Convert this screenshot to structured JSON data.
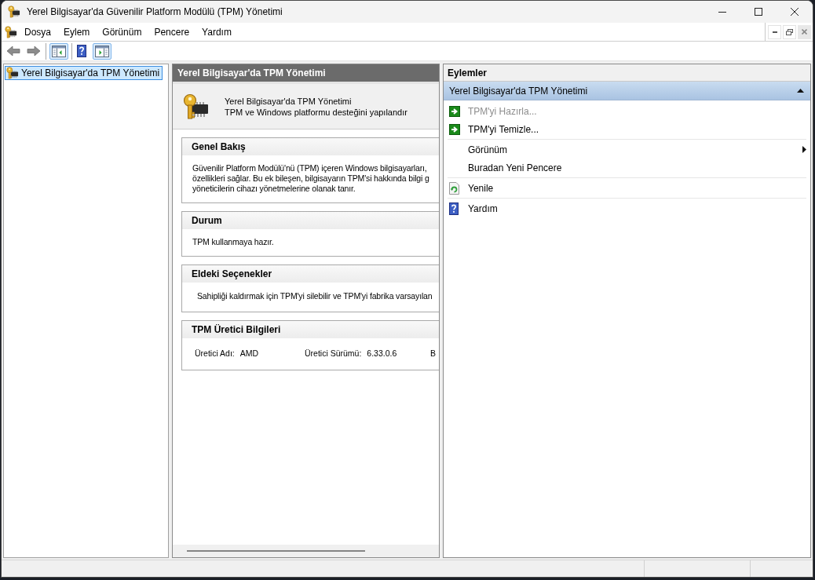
{
  "window": {
    "title": "Yerel Bilgisayar'da Güvenilir Platform Modülü (TPM) Yönetimi"
  },
  "menu_bar": {
    "items": [
      "Dosya",
      "Eylem",
      "Görünüm",
      "Pencere",
      "Yardım"
    ]
  },
  "toolbar": {
    "history": [
      {
        "kind": "back",
        "disabled": true
      },
      {
        "kind": "forward",
        "disabled": true
      }
    ],
    "console_tree_toggle": {
      "checked": true
    },
    "action_pane_toggle": {
      "checked": true
    }
  },
  "tree": {
    "items": [
      {
        "label": "Yerel Bilgisayar'da TPM Yönetimi",
        "selected": true
      }
    ]
  },
  "result_pane": {
    "title": "Yerel Bilgisayar'da TPM Yönetimi",
    "banner": {
      "title": "Yerel Bilgisayar'da TPM Yönetimi",
      "subtitle": "TPM ve Windows platformu desteğini yapılandır"
    },
    "sections": [
      {
        "kind": "text",
        "title": "Genel Bakış",
        "lines": [
          "Güvenilir Platform Modülü'nü (TPM) içeren Windows bilgisayarları,",
          "özellikleri sağlar. Bu ek bileşen, bilgisayarın TPM'si hakkında bilgi g",
          "yöneticilerin cihazı yönetmelerine olanak tanır."
        ]
      },
      {
        "kind": "text",
        "title": "Durum",
        "lines": [
          "TPM kullanmaya hazır."
        ]
      },
      {
        "kind": "options",
        "title": "Eldeki Seçenekler",
        "lines": [
          "Sahipliği kaldırmak için TPM'yi silebilir ve TPM'yi fabrika varsayılan"
        ]
      },
      {
        "kind": "fields",
        "title": "TPM Üretici Bilgileri",
        "fields": [
          {
            "label": "Üretici Adı:",
            "value": "AMD"
          },
          {
            "label": "Üretici Sürümü:",
            "value": "6.33.0.6"
          },
          {
            "label": "B"
          }
        ]
      }
    ]
  },
  "actions_pane": {
    "title": "Eylemler",
    "groups": [
      {
        "title": "Yerel Bilgisayar'da TPM Yönetimi",
        "expanded": true,
        "sections": [
          {
            "items": [
              {
                "kind": "command",
                "label": "TPM'yi Hazırla...",
                "disabled": true,
                "submenu": false
              },
              {
                "kind": "command",
                "label": "TPM'yi Temizle...",
                "disabled": false,
                "submenu": false
              }
            ]
          },
          {
            "items": [
              {
                "kind": "plain",
                "label": "Görünüm",
                "disabled": false,
                "submenu": true
              },
              {
                "kind": "plain",
                "label": "Buradan Yeni Pencere",
                "disabled": false,
                "submenu": false
              }
            ]
          },
          {
            "items": [
              {
                "kind": "refresh",
                "label": "Yenile",
                "disabled": false,
                "submenu": false
              }
            ]
          },
          {
            "items": [
              {
                "kind": "help",
                "label": "Yardım",
                "disabled": false,
                "submenu": false
              }
            ]
          }
        ]
      }
    ]
  }
}
